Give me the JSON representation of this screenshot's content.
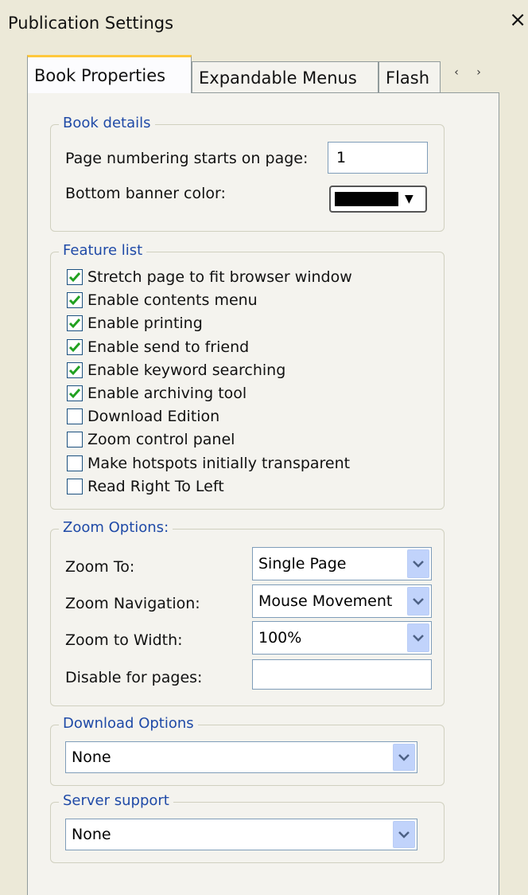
{
  "window": {
    "title": "Publication Settings",
    "close_glyph": "×"
  },
  "tabs": [
    {
      "label": "Book Properties",
      "active": true
    },
    {
      "label": "Expandable Menus",
      "active": false
    },
    {
      "label": "Flash",
      "active": false
    }
  ],
  "tab_scroll": {
    "left": "‹",
    "right": "›"
  },
  "book_details": {
    "legend": "Book details",
    "page_numbering_label": "Page numbering starts on page:",
    "page_numbering_value": "1",
    "banner_color_label": "Bottom banner color:",
    "banner_color": "#000000",
    "banner_arrow": "▼"
  },
  "feature_list": {
    "legend": "Feature list",
    "items": [
      {
        "label": "Stretch page to fit browser window",
        "checked": true
      },
      {
        "label": "Enable contents menu",
        "checked": true
      },
      {
        "label": "Enable printing",
        "checked": true
      },
      {
        "label": "Enable send to friend",
        "checked": true
      },
      {
        "label": "Enable keyword searching",
        "checked": true
      },
      {
        "label": "Enable archiving tool",
        "checked": true
      },
      {
        "label": "Download Edition",
        "checked": false
      },
      {
        "label": "Zoom control panel",
        "checked": false
      },
      {
        "label": "Make hotspots initially transparent",
        "checked": false
      },
      {
        "label": "Read Right To Left",
        "checked": false
      }
    ]
  },
  "zoom_options": {
    "legend": "Zoom Options:",
    "zoom_to_label": "Zoom To:",
    "zoom_to_value": "Single Page",
    "zoom_nav_label": "Zoom Navigation:",
    "zoom_nav_value": "Mouse Movement",
    "zoom_width_label": "Zoom to Width:",
    "zoom_width_value": "100%",
    "disable_label": "Disable for pages:",
    "disable_value": ""
  },
  "download_options": {
    "legend": "Download Options",
    "value": "None"
  },
  "server_support": {
    "legend": "Server support",
    "value": "None"
  },
  "colors": {
    "legend_text": "#1f4aa7",
    "window_bg": "#ece9d8",
    "dropdown_button": "#c1d3fb",
    "active_tab_highlight": "#ffc83c",
    "checkmark": "#21a121"
  }
}
